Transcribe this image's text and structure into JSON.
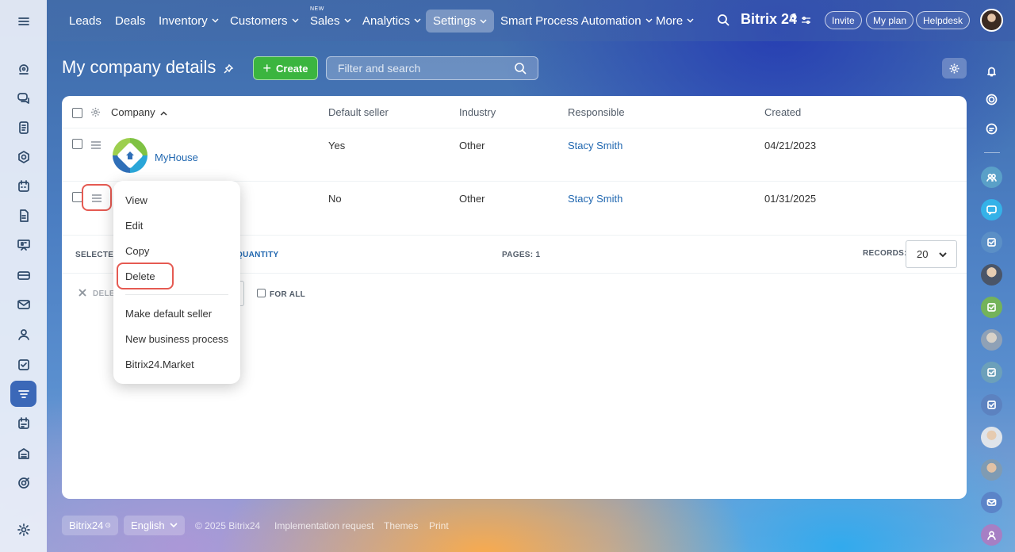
{
  "topbar": {
    "menu_icon": "hamburger-icon",
    "nav": [
      {
        "label": "Leads",
        "has_chevron": false
      },
      {
        "label": "Deals",
        "has_chevron": false
      },
      {
        "label": "Inventory",
        "has_chevron": true
      },
      {
        "label": "Customers",
        "has_chevron": true
      },
      {
        "label": "Sales",
        "has_chevron": true,
        "badge": "NEW"
      },
      {
        "label": "Analytics",
        "has_chevron": true
      },
      {
        "label": "Settings",
        "has_chevron": true,
        "active": true
      },
      {
        "label": "Smart Process Automation",
        "has_chevron": true
      },
      {
        "label": "More",
        "has_chevron": true
      }
    ],
    "brand": "Bitrix 24",
    "invite_label": "Invite",
    "plan_label": "My plan",
    "helpdesk_label": "Helpdesk"
  },
  "page": {
    "title": "My company details",
    "create_label": "Create",
    "search_placeholder": "Filter and search"
  },
  "table": {
    "columns": [
      "Company",
      "Default seller",
      "Industry",
      "Responsible",
      "Created"
    ],
    "rows": [
      {
        "company": "MyHouse",
        "default_seller": "Yes",
        "industry": "Other",
        "responsible": "Stacy Smith",
        "created": "04/21/2023"
      },
      {
        "company": "",
        "default_seller": "No",
        "industry": "Other",
        "responsible": "Stacy Smith",
        "created": "01/31/2025"
      }
    ],
    "footer": {
      "selected_label": "SELECTED",
      "quantity_label": "QUANTITY",
      "pages_label": "PAGES:",
      "pages_value": "1",
      "records_label": "RECORDS:",
      "records_value": "20"
    },
    "actions": {
      "delete_label": "DELE",
      "for_all_label": "FOR ALL"
    }
  },
  "context_menu": {
    "items": [
      "View",
      "Edit",
      "Copy",
      "Delete",
      "Make default seller",
      "New business process",
      "Bitrix24.Market"
    ]
  },
  "footer": {
    "brand": "Bitrix24",
    "language": "English",
    "copyright": "© 2025 Bitrix24",
    "links": [
      "Implementation request",
      "Themes",
      "Print"
    ]
  },
  "colors": {
    "accent": "#3b68b8",
    "create_green": "#3bb53f",
    "link_blue": "#2067b0",
    "highlight_red": "#e55a52"
  }
}
